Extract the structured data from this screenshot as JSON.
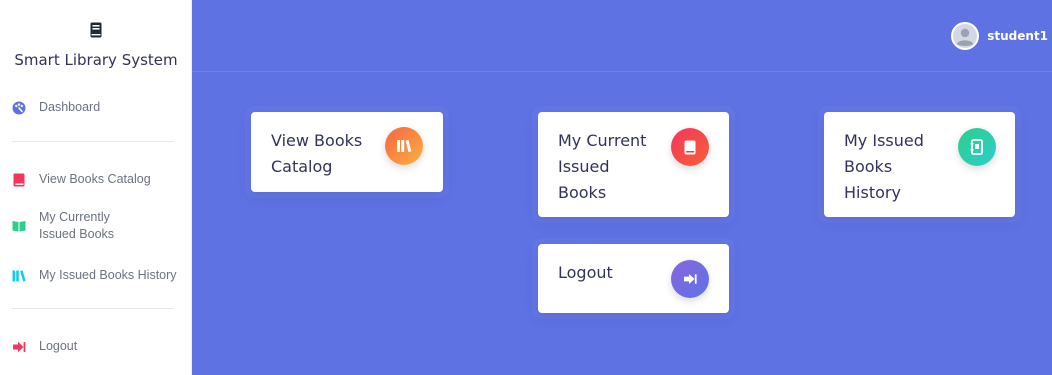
{
  "brand": {
    "title": "Smart Library System",
    "icon": "book-icon"
  },
  "sidebar": {
    "items": [
      {
        "label": "Dashboard",
        "icon": "palette-dashboard-icon",
        "color": "#5e72e4"
      },
      {
        "label": "View Books Catalog",
        "icon": "book-icon",
        "color": "#f5365c"
      },
      {
        "label": "My Currently Issued Books",
        "icon": "open-book-icon",
        "color": "#2dce89"
      },
      {
        "label": "My Issued Books History",
        "icon": "books-shelf-icon",
        "color": "#11cdef"
      },
      {
        "label": "Logout",
        "icon": "sign-out-icon",
        "color": "#f5365c"
      }
    ]
  },
  "user": {
    "name": "student1"
  },
  "cards": [
    {
      "title": "View Books\nCatalog",
      "icon": "books-shelf-icon",
      "color_from": "#fb6340",
      "color_to": "#fbb140"
    },
    {
      "title": "My Current\nIssued\nBooks",
      "icon": "book-icon",
      "color_from": "#f5365c",
      "color_to": "#f56036"
    },
    {
      "title": "My Issued\nBooks\nHistory",
      "icon": "address-book-icon",
      "color_from": "#2dce89",
      "color_to": "#2dcecc"
    },
    {
      "title": "Logout",
      "icon": "sign-out-icon",
      "color_from": "#8965e0",
      "color_to": "#5e72e4"
    }
  ]
}
